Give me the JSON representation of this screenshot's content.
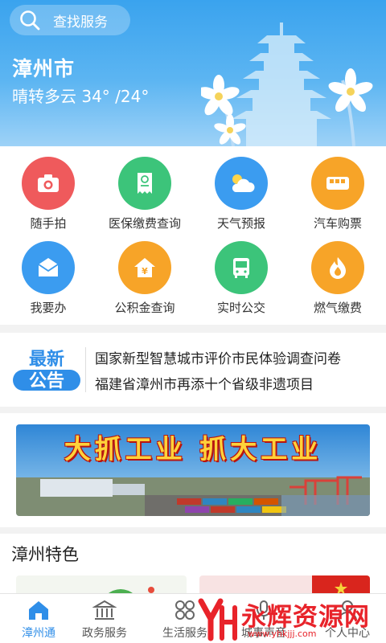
{
  "header": {
    "search_placeholder": "查找服务",
    "city": "漳州市",
    "weather": "晴转多云 34° /24°"
  },
  "services": [
    {
      "label": "随手拍",
      "icon": "camera-icon",
      "color": "#ef5a5c"
    },
    {
      "label": "医保缴费查询",
      "icon": "receipt-icon",
      "color": "#3cc47a"
    },
    {
      "label": "天气预报",
      "icon": "weather-icon",
      "color": "#3b9cf0"
    },
    {
      "label": "汽车购票",
      "icon": "bus-ticket-icon",
      "color": "#f7a428"
    },
    {
      "label": "我要办",
      "icon": "envelope-icon",
      "color": "#3b9cf0"
    },
    {
      "label": "公积金查询",
      "icon": "house-fund-icon",
      "color": "#f7a428"
    },
    {
      "label": "实时公交",
      "icon": "bus-icon",
      "color": "#3cc47a"
    },
    {
      "label": "燃气缴费",
      "icon": "flame-icon",
      "color": "#f7a428"
    }
  ],
  "notice": {
    "badge_line1": "最新",
    "badge_line2": "公告",
    "items": [
      "国家新型智慧城市评价市民体验调查问卷",
      "福建省漳州市再添十个省级非遗项目"
    ]
  },
  "banner": {
    "text": "大抓工业 抓大工业"
  },
  "features": {
    "title": "漳州特色"
  },
  "tabbar": [
    {
      "label": "漳州通",
      "icon": "home-icon",
      "active": true
    },
    {
      "label": "政务服务",
      "icon": "government-building-icon",
      "active": false
    },
    {
      "label": "生活服务",
      "icon": "grid-icon",
      "active": false
    },
    {
      "label": "城事声音",
      "icon": "voice-icon",
      "active": false
    },
    {
      "label": "个人中心",
      "icon": "person-icon",
      "active": false
    }
  ],
  "watermark": {
    "text": "永辉资源网",
    "url": "www.yhkjjj.com"
  },
  "colors": {
    "accent": "#2f8ee8",
    "header_top": "#3aa3ee",
    "watermark_red": "#e8232a"
  }
}
